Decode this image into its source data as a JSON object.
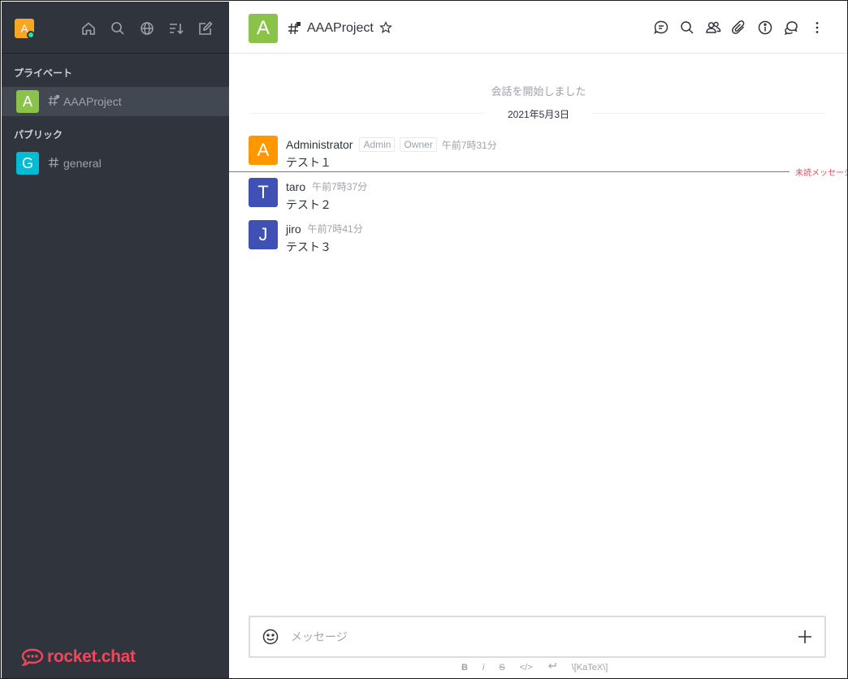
{
  "sidebar": {
    "user_avatar_letter": "A",
    "sections": {
      "private": "プライベート",
      "public": "パブリック"
    },
    "rooms": [
      {
        "letter": "A",
        "name": "AAAProject",
        "color": "#8bc34a",
        "active": true
      },
      {
        "letter": "G",
        "name": "general",
        "color": "#00bcd4",
        "active": false
      }
    ],
    "icons": [
      "home-icon",
      "search-icon",
      "directory-icon",
      "sort-icon",
      "create-new-icon"
    ],
    "logo_text": "rocket.chat"
  },
  "header": {
    "avatar_letter": "A",
    "title": "AAAProject",
    "actions": [
      "discussion-icon",
      "search-icon",
      "members-icon",
      "attachment-icon",
      "info-icon",
      "threads-icon",
      "kebab-menu-icon"
    ]
  },
  "conversation": {
    "start_text": "会話を開始しました",
    "date": "2021年5月3日",
    "unread_label": "未読メッセージ",
    "messages": [
      {
        "letter": "A",
        "color": "#ff9800",
        "user": "Administrator",
        "roles": [
          "Admin",
          "Owner"
        ],
        "time": "午前7時31分",
        "text": "テスト１"
      },
      {
        "letter": "T",
        "color": "#3f51b5",
        "user": "taro",
        "roles": [],
        "time": "午前7時37分",
        "text": "テスト２"
      },
      {
        "letter": "J",
        "color": "#3f51b5",
        "user": "jiro",
        "roles": [],
        "time": "午前7時41分",
        "text": "テスト３"
      }
    ]
  },
  "composer": {
    "placeholder": "メッセージ",
    "value": ""
  },
  "formatting": {
    "bold": "B",
    "italic": "i",
    "strike": "S",
    "code": "</>",
    "katex": "\\[KaTeX\\]"
  },
  "colors": {
    "sidebar_bg": "#2f343d",
    "accent": "#f5455c",
    "unread": "#e34a5f",
    "status_online": "#2de0a5"
  }
}
